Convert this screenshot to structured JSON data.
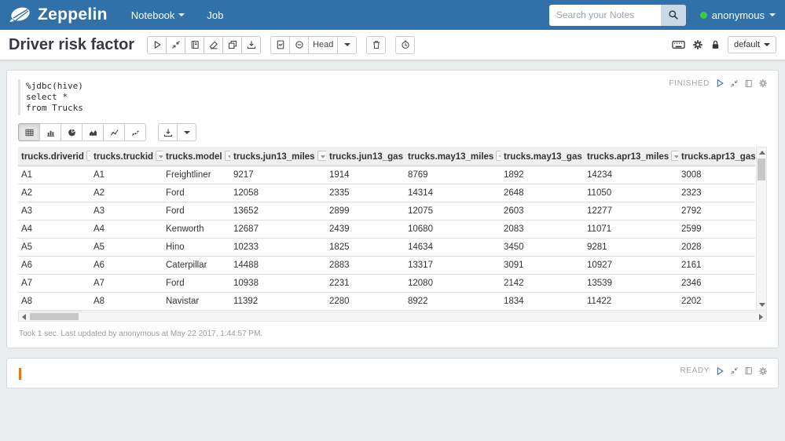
{
  "navbar": {
    "brand": "Zeppelin",
    "menus": [
      {
        "label": "Notebook",
        "caret": true
      },
      {
        "label": "Job",
        "caret": false
      }
    ],
    "search_placeholder": "Search your Notes",
    "user": "anonymous"
  },
  "note": {
    "title": "Driver risk factor",
    "revision_label": "Head",
    "interpreter_label": "default"
  },
  "p1": {
    "status": "FINISHED",
    "code_lines": [
      "%jdbc(hive)",
      "select *",
      "from Trucks"
    ],
    "footer": "Took 1 sec. Last updated by anonymous at May 22 2017, 1:44:57 PM."
  },
  "p2": {
    "status": "READY"
  },
  "table": {
    "columns": [
      "trucks.driverid",
      "trucks.truckid",
      "trucks.model",
      "trucks.jun13_miles",
      "trucks.jun13_gas",
      "trucks.may13_miles",
      "trucks.may13_gas",
      "trucks.apr13_miles",
      "trucks.apr13_gas"
    ],
    "rows": [
      [
        "A1",
        "A1",
        "Freightliner",
        "9217",
        "1914",
        "8769",
        "1892",
        "14234",
        "3008"
      ],
      [
        "A2",
        "A2",
        "Ford",
        "12058",
        "2335",
        "14314",
        "2648",
        "11050",
        "2323"
      ],
      [
        "A3",
        "A3",
        "Ford",
        "13652",
        "2899",
        "12075",
        "2603",
        "12277",
        "2792"
      ],
      [
        "A4",
        "A4",
        "Kenworth",
        "12687",
        "2439",
        "10680",
        "2083",
        "11071",
        "2599"
      ],
      [
        "A5",
        "A5",
        "Hino",
        "10233",
        "1825",
        "14634",
        "3450",
        "9281",
        "2028"
      ],
      [
        "A6",
        "A6",
        "Caterpillar",
        "14488",
        "2883",
        "13317",
        "3091",
        "10927",
        "2161"
      ],
      [
        "A7",
        "A7",
        "Ford",
        "10938",
        "2231",
        "12080",
        "2142",
        "13539",
        "2346"
      ],
      [
        "A8",
        "A8",
        "Navistar",
        "11392",
        "2280",
        "8922",
        "1834",
        "11422",
        "2202"
      ]
    ]
  },
  "chart_controls": [
    "table",
    "bar-chart",
    "pie-chart",
    "area-chart",
    "line-chart",
    "scatter-chart"
  ],
  "colors": {
    "navbar_blue": "#3071a9",
    "play_blue": "#3a7cc0",
    "status_gray": "#a2a6a9",
    "user_status_green": "#3ec93e",
    "cursor_orange": "#e87715"
  },
  "icons": {
    "zeppelin-logo-icon": "white airship",
    "search-icon": "magnifier",
    "run-all-icon": "play outline",
    "toggle-code-icon": "compress arrows",
    "toggle-output-icon": "book",
    "clear-output-icon": "eraser",
    "clone-note-icon": "two sheets",
    "export-note-icon": "download arrow",
    "commit-icon": "document",
    "set-revision-icon": "circle minus",
    "remove-note-icon": "trash can",
    "scheduler-icon": "clock",
    "shortcut-icon": "keyboard",
    "interpreter-gear-icon": "gear",
    "permissions-lock-icon": "padlock",
    "table-view-icon": "grid",
    "bar-chart-icon": "bars",
    "pie-chart-icon": "pie",
    "area-chart-icon": "area",
    "line-chart-icon": "line",
    "scatter-chart-icon": "scatter points"
  }
}
